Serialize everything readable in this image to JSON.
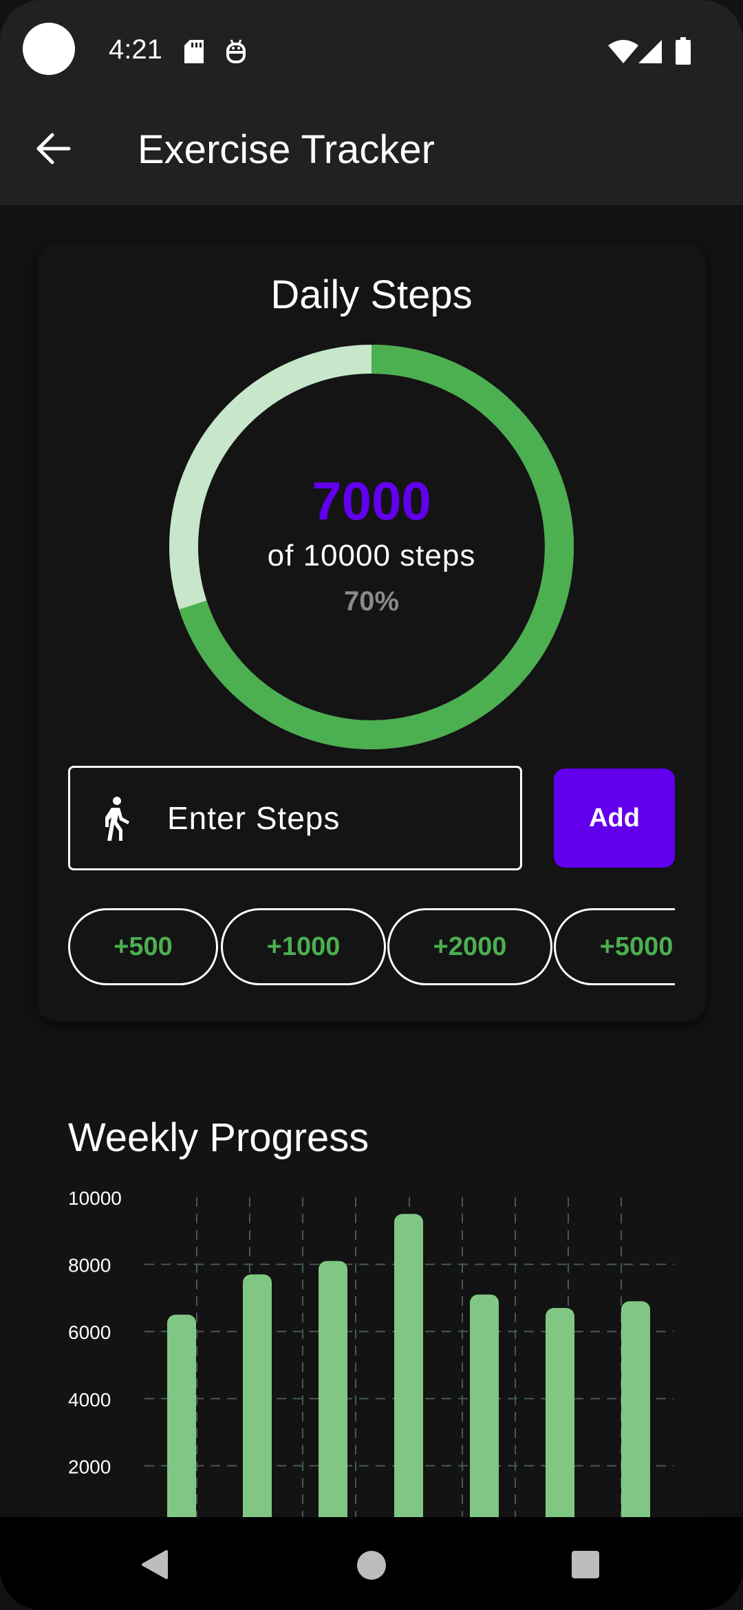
{
  "status_bar": {
    "time": "4:21"
  },
  "app_bar": {
    "title": "Exercise Tracker"
  },
  "daily_steps": {
    "title": "Daily Steps",
    "steps": "7000",
    "goal_text": "of 10000 steps",
    "percent_text": "70%",
    "progress": 0.7,
    "colors": {
      "progress": "#4CAF50",
      "track": "#C8E6C9",
      "accent": "#6200EE"
    }
  },
  "entry": {
    "placeholder": "Enter Steps",
    "add_label": "Add"
  },
  "quick_add": [
    "+500",
    "+1000",
    "+2000",
    "+5000"
  ],
  "weekly": {
    "title": "Weekly Progress"
  },
  "chart_data": {
    "type": "bar",
    "title": "Weekly Progress",
    "xlabel": "",
    "ylabel": "",
    "ylim": [
      0,
      10000
    ],
    "yticks": [
      "10000",
      "8000",
      "6000",
      "4000",
      "2000"
    ],
    "values": [
      6500,
      7700,
      8100,
      9500,
      7100,
      6700,
      6900
    ],
    "color": "#81C784",
    "grid": true
  }
}
